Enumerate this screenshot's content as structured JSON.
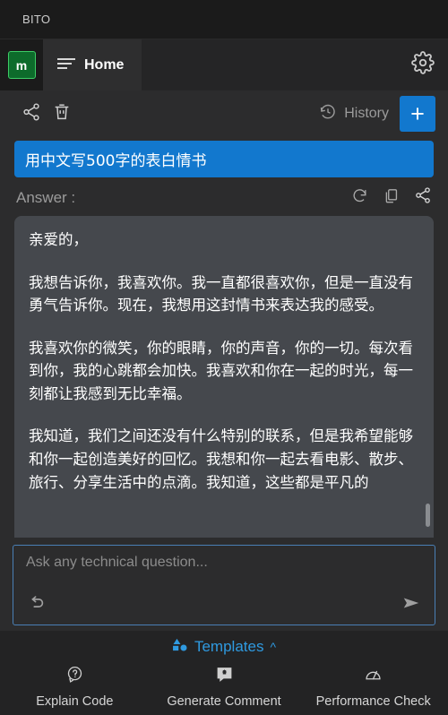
{
  "window": {
    "title": "BITO"
  },
  "tabbar": {
    "avatar_initial": "m",
    "avatar_name": "avatar",
    "tab_label": "Home",
    "menu_icon": "menu-lines-icon",
    "settings_icon": "gear-icon"
  },
  "actionrow": {
    "share_icon": "share-icon",
    "delete_icon": "trash-icon",
    "history_icon": "history-clock-icon",
    "history_label": "History",
    "new_chat_label": "+"
  },
  "conversation": {
    "question": "用中文写500字的表白情书",
    "answer_label": "Answer :",
    "tools": {
      "regenerate_icon": "refresh-icon",
      "copy_icon": "copy-icon",
      "share_icon": "share-icon"
    },
    "answer_paragraphs": [
      "亲爱的，",
      "我想告诉你，我喜欢你。我一直都很喜欢你，但是一直没有勇气告诉你。现在，我想用这封情书来表达我的感受。",
      "我喜欢你的微笑，你的眼睛，你的声音，你的一切。每次看到你，我的心跳都会加快。我喜欢和你在一起的时光，每一刻都让我感到无比幸福。",
      "我知道，我们之间还没有什么特别的联系，但是我希望能够和你一起创造美好的回忆。我想和你一起去看电影、散步、旅行、分享生活中的点滴。我知道，这些都是平凡的"
    ]
  },
  "composer": {
    "placeholder": "Ask any technical question...",
    "undo_icon": "undo-arrow-icon",
    "send_icon": "send-arrow-icon"
  },
  "bottombar": {
    "templates_label": "Templates",
    "templates_icon": "shapes-icon",
    "templates_chevron": "^",
    "actions": [
      {
        "label": "Explain Code",
        "icon": "question-bubble-icon"
      },
      {
        "label": "Generate Comment",
        "icon": "comment-bubble-icon"
      },
      {
        "label": "Performance Check",
        "icon": "gauge-icon"
      }
    ]
  },
  "colors": {
    "accent_blue": "#1278ce",
    "link_blue": "#2f9ae0",
    "avatar_green": "#0d6b2b",
    "answer_bg": "#45484d"
  }
}
